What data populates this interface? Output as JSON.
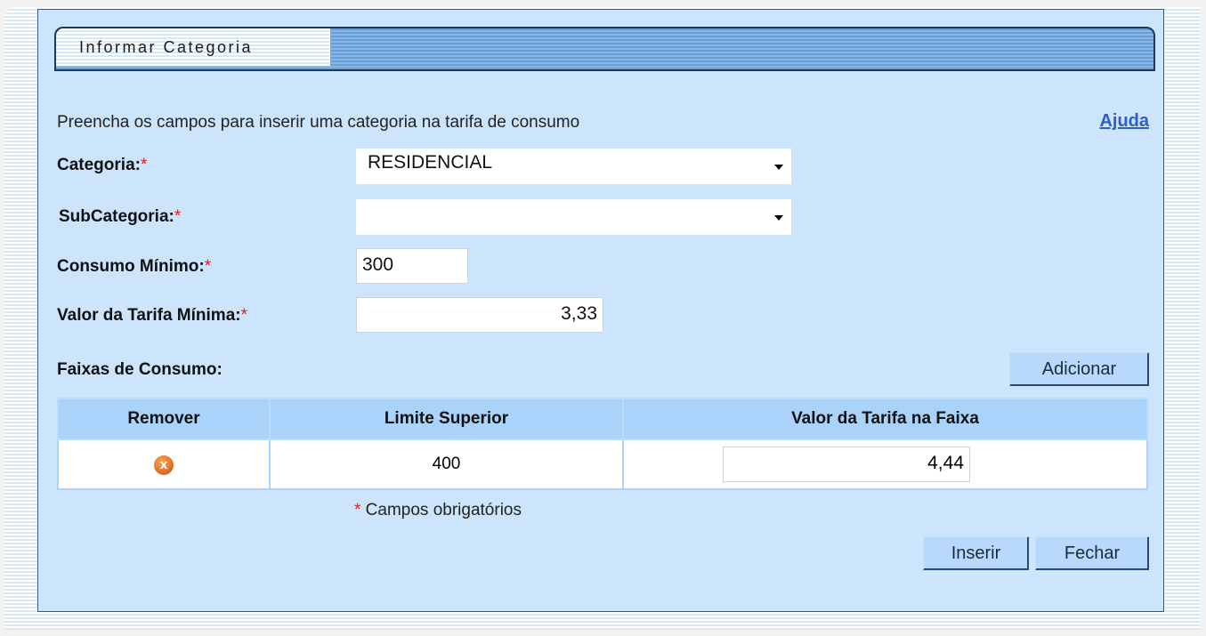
{
  "window": {
    "title": "Informar Categoria"
  },
  "form": {
    "hint": "Preencha os campos para inserir uma categoria na tarifa de consumo",
    "help_label": "Ajuda",
    "required_mark": "*",
    "categoria": {
      "label": "Categoria:",
      "value": "RESIDENCIAL"
    },
    "subcategoria": {
      "label": "SubCategoria:",
      "value": ""
    },
    "consumo_minimo": {
      "label": "Consumo Mínimo:",
      "value": "300"
    },
    "valor_tarifa_minima": {
      "label": "Valor da Tarifa Mínima:",
      "value": "3,33"
    },
    "faixas_label": "Faixas de Consumo:",
    "adicionar_label": "Adicionar"
  },
  "table": {
    "headers": [
      "Remover",
      "Limite Superior",
      "Valor da Tarifa na Faixa"
    ],
    "rows": [
      {
        "limite_superior": "400",
        "valor_tarifa": "4,44",
        "remove_icon": "remove-circle-x-icon"
      }
    ]
  },
  "footer": {
    "footnote_mark": "*",
    "footnote_text": " Campos obrigatórios",
    "inserir_label": "Inserir",
    "fechar_label": "Fechar"
  }
}
